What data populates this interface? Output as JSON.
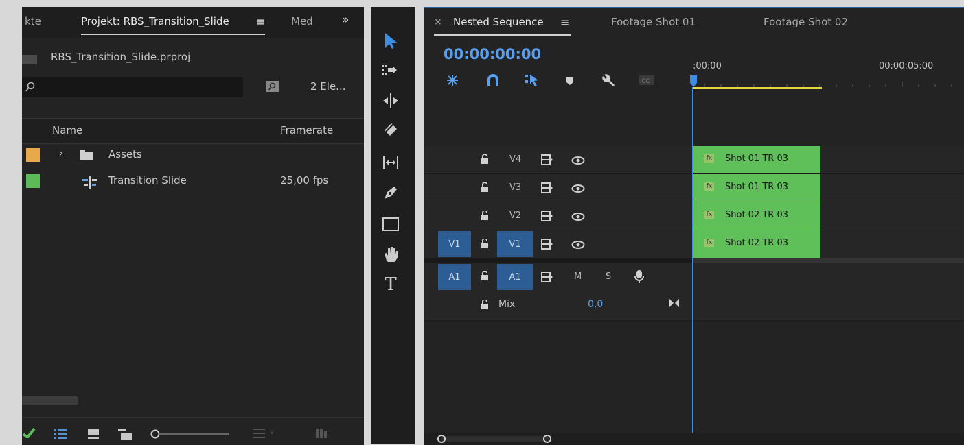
{
  "project_panel": {
    "tabs": [
      "kte",
      "Projekt: RBS_Transition_Slide",
      "Med"
    ],
    "tab_menu_symbol": "≡",
    "overflow_symbol": "»",
    "project_file": "RBS_Transition_Slide.prproj",
    "search_placeholder": "",
    "item_count": "2 Ele...",
    "columns": {
      "name": "Name",
      "framerate": "Framerate"
    },
    "items": [
      {
        "name": "Assets",
        "type": "folder",
        "color": "#e8a94a",
        "framerate": ""
      },
      {
        "name": "Transition Slide",
        "type": "sequence",
        "color": "#5dbb57",
        "framerate": "25,00 fps"
      }
    ]
  },
  "tools": [
    "selection-tool",
    "track-select-tool",
    "ripple-edit-tool",
    "razor-tool",
    "slip-tool",
    "pen-tool",
    "rectangle-tool",
    "hand-tool",
    "type-tool"
  ],
  "timeline": {
    "tabs": [
      {
        "label": "Nested Sequence",
        "active": true
      },
      {
        "label": "Footage Shot 01",
        "active": false
      },
      {
        "label": "Footage Shot 02",
        "active": false
      }
    ],
    "close_symbol": "×",
    "menu_symbol": "≡",
    "timecode": "00:00:00:00",
    "ruler": {
      "start": ":00:00",
      "mark": "00:00:05:00"
    },
    "video_tracks": [
      {
        "name": "V4",
        "source": ""
      },
      {
        "name": "V3",
        "source": ""
      },
      {
        "name": "V2",
        "source": ""
      },
      {
        "name": "V1",
        "source": "V1"
      }
    ],
    "audio_tracks": [
      {
        "name": "A1",
        "source": "A1",
        "m": "M",
        "s": "S"
      }
    ],
    "mix": {
      "label": "Mix",
      "value": "0,0"
    },
    "clips": [
      {
        "track": "V4",
        "label": "Shot 01 TR 03"
      },
      {
        "track": "V3",
        "label": "Shot 01 TR 03"
      },
      {
        "track": "V2",
        "label": "Shot 02 TR 03"
      },
      {
        "track": "V1",
        "label": "Shot 02 TR 03"
      }
    ],
    "fx_badge": "fx"
  },
  "colors": {
    "accent_blue": "#2c5d95",
    "clip_green": "#5fbf59",
    "playhead": "#3d8ee6",
    "work_area": "#e8d43a"
  }
}
